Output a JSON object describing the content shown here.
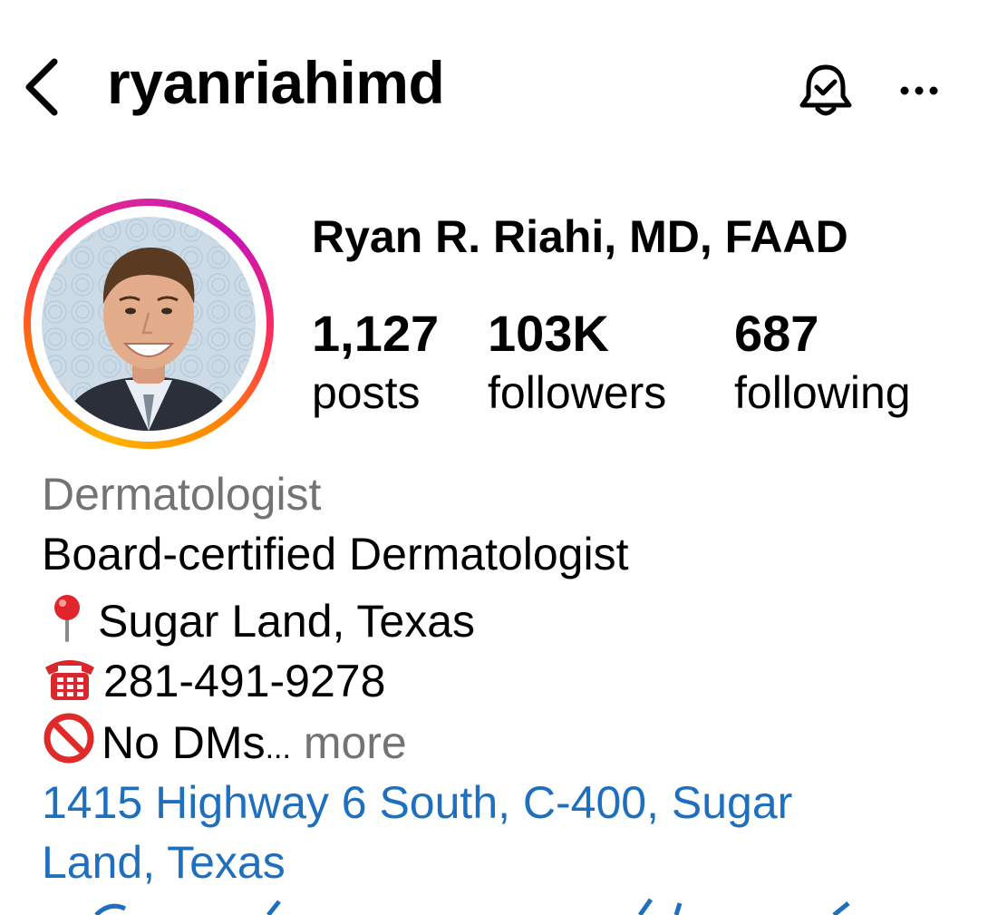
{
  "header": {
    "username": "ryanriahimd",
    "back_icon": "chevron-left-icon",
    "bell_icon": "bell-check-icon",
    "more_icon": "ellipsis-icon"
  },
  "profile": {
    "display_name": "Ryan R. Riahi, MD, FAAD",
    "stats": [
      {
        "value": "1,127",
        "label": "posts"
      },
      {
        "value": "103K",
        "label": "followers"
      },
      {
        "value": "687",
        "label": "following"
      }
    ],
    "category": "Dermatologist",
    "bio": {
      "line1": "Board-certified Dermatologist",
      "location": "Sugar Land, Texas",
      "phone": "281-491-9278",
      "note": "No DMs",
      "ellipsis": "...",
      "more": " more"
    },
    "address_line1": "1415 Highway 6 South, C-400, Sugar",
    "address_line2": "Land, Texas"
  },
  "colors": {
    "link": "#1f6fbf",
    "muted": "#737373"
  }
}
